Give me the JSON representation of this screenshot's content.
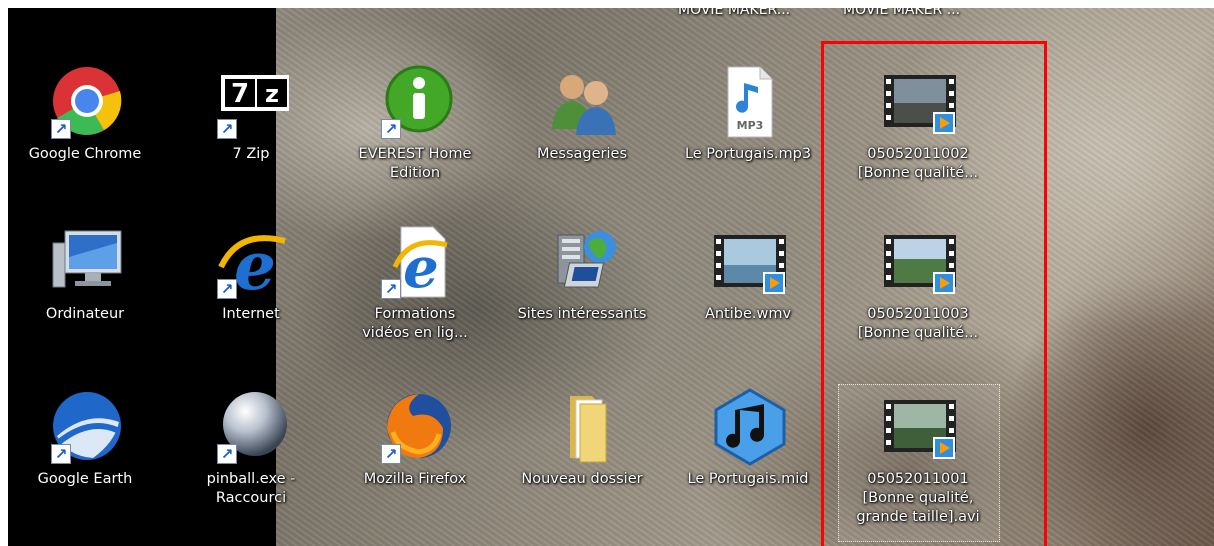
{
  "desktop": {
    "top_labels": [
      "MOVIE MAKER...",
      "MOVIE MAKER ..."
    ],
    "icons": [
      {
        "label": "Google Chrome",
        "icon": "chrome-icon",
        "shortcut": true
      },
      {
        "label": "7 Zip",
        "icon": "seven-zip-icon",
        "shortcut": true
      },
      {
        "label": "EVEREST Home\nEdition",
        "icon": "everest-info-icon",
        "shortcut": true
      },
      {
        "label": "Messageries",
        "icon": "messenger-users-icon",
        "shortcut": false
      },
      {
        "label": "Le Portugais.mp3",
        "icon": "mp3-file-icon",
        "shortcut": false
      },
      {
        "label": "05052011002\n[Bonne qualité...",
        "icon": "video-file-icon",
        "shortcut": false
      },
      {
        "label": "Ordinateur",
        "icon": "computer-icon",
        "shortcut": false
      },
      {
        "label": "Internet",
        "icon": "internet-explorer-icon",
        "shortcut": true
      },
      {
        "label": "Formations\nvidéos en lig...",
        "icon": "ie-document-icon",
        "shortcut": true
      },
      {
        "label": "Sites intéressants",
        "icon": "network-folder-icon",
        "shortcut": false
      },
      {
        "label": "Antibe.wmv",
        "icon": "video-file-icon",
        "shortcut": false
      },
      {
        "label": "05052011003\n[Bonne qualité...",
        "icon": "video-file-icon",
        "shortcut": false
      },
      {
        "label": "Google Earth",
        "icon": "google-earth-icon",
        "shortcut": true
      },
      {
        "label": "pinball.exe -\nRaccourci",
        "icon": "pinball-icon",
        "shortcut": true
      },
      {
        "label": "Mozilla Firefox",
        "icon": "firefox-icon",
        "shortcut": true
      },
      {
        "label": "Nouveau dossier",
        "icon": "folder-icon",
        "shortcut": false
      },
      {
        "label": "Le Portugais.mid",
        "icon": "midi-file-icon",
        "shortcut": false
      },
      {
        "label": "05052011001\n[Bonne qualité,\ngrande taille].avi",
        "icon": "video-file-icon",
        "shortcut": false,
        "selected": true
      }
    ]
  },
  "highlight": {
    "color": "#ff0000"
  }
}
